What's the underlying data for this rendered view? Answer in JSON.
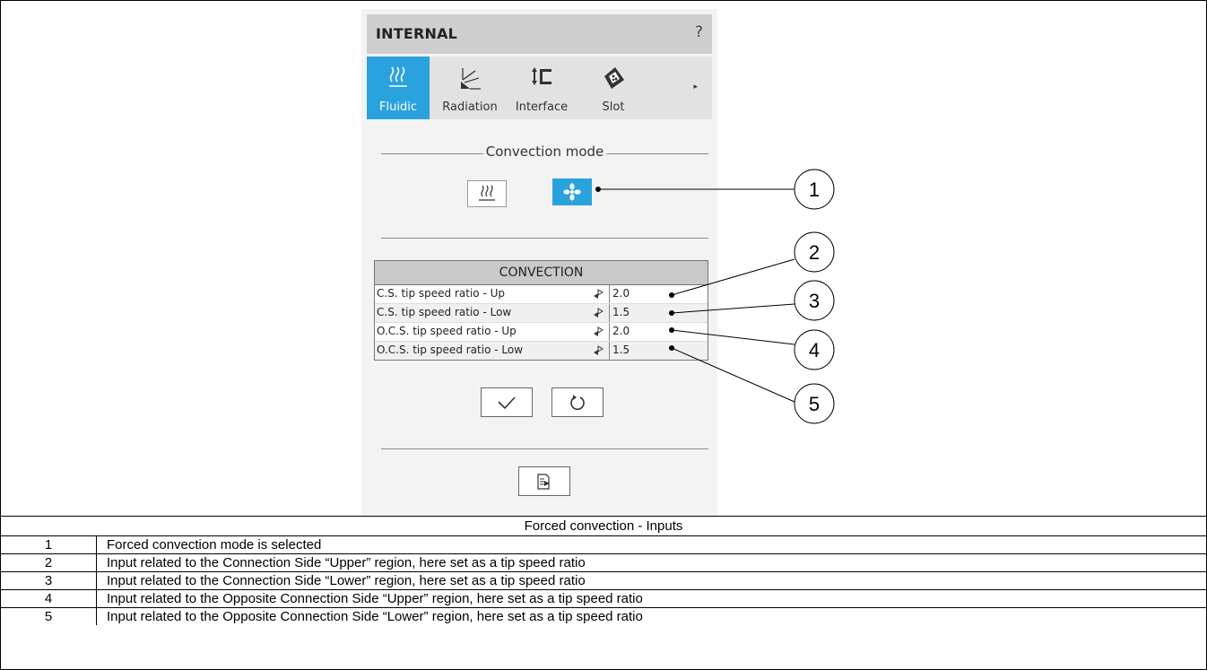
{
  "panel": {
    "title": "INTERNAL",
    "help": "?",
    "tabs": [
      {
        "label": "Fluidic",
        "icon": "heat-waves-icon",
        "active": true
      },
      {
        "label": "Radiation",
        "icon": "radiation-icon",
        "active": false
      },
      {
        "label": "Interface",
        "icon": "interface-icon",
        "active": false
      },
      {
        "label": "Slot",
        "icon": "slot-icon",
        "active": false
      }
    ],
    "more_arrow": "▸",
    "convection_mode": {
      "label": "Convection mode",
      "options": [
        {
          "name": "natural",
          "icon": "natural-convection-icon",
          "selected": false
        },
        {
          "name": "forced",
          "icon": "fan-icon",
          "selected": true
        }
      ]
    },
    "convection_table": {
      "title": "CONVECTION",
      "rows": [
        {
          "label": "C.S. tip speed ratio - Up",
          "value": "2.0"
        },
        {
          "label": "C.S. tip speed ratio - Low",
          "value": "1.5"
        },
        {
          "label": "O.C.S. tip speed ratio - Up",
          "value": "2.0"
        },
        {
          "label": "O.C.S. tip speed ratio - Low",
          "value": "1.5"
        }
      ]
    },
    "actions": {
      "apply_icon": "checkmark-icon",
      "reset_icon": "reset-icon",
      "export_icon": "export-icon"
    }
  },
  "callouts": [
    "1",
    "2",
    "3",
    "4",
    "5"
  ],
  "caption": "Forced convection - Inputs",
  "legend": [
    {
      "num": "1",
      "text": "Forced convection mode is selected"
    },
    {
      "num": "2",
      "text": "Input related to the Connection Side “Upper” region, here set as a tip speed ratio"
    },
    {
      "num": "3",
      "text": "Input related to the Connection Side “Lower” region, here set as a tip speed ratio"
    },
    {
      "num": "4",
      "text": "Input related to the Opposite Connection Side “Upper” region, here set as a tip speed ratio"
    },
    {
      "num": "5",
      "text": "Input related to the Opposite Connection Side “Lower” region, here set as a tip speed ratio"
    }
  ],
  "colors": {
    "accent": "#2aa2de",
    "header_bg": "#cfcfcf",
    "tabbar_bg": "#e2e2e2",
    "panel_bg": "#f3f3f3"
  }
}
